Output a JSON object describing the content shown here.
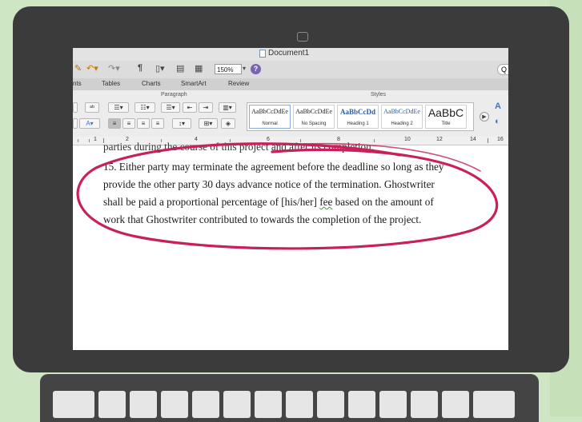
{
  "window": {
    "title": "Document1"
  },
  "toolbar": {
    "zoom": "150%",
    "help_label": "?",
    "search_label": "Q"
  },
  "tabs": [
    {
      "label": "nts"
    },
    {
      "label": "Tables"
    },
    {
      "label": "Charts"
    },
    {
      "label": "SmartArt"
    },
    {
      "label": "Review"
    }
  ],
  "ribbon": {
    "paragraph_group": "Paragraph",
    "styles_group": "Styles",
    "styles": [
      {
        "sample": "AaBbCcDdEe",
        "name": "Normal"
      },
      {
        "sample": "AaBbCcDdEe",
        "name": "No Spacing"
      },
      {
        "sample": "AaBbCcDd",
        "name": "Heading 1"
      },
      {
        "sample": "AaBbCcDdEe",
        "name": "Heading 2"
      },
      {
        "sample": "AaBbC",
        "name": "Title"
      }
    ]
  },
  "ruler": {
    "labels": [
      "1",
      "2",
      "4",
      "6",
      "8",
      "10",
      "12",
      "14",
      "16"
    ]
  },
  "document": {
    "clipped_line": "parties during the course of this project and after its completion.",
    "lines": [
      "15. Either party may terminate the agreement before the deadline so long as they",
      "provide the other party 30 days advance notice of the termination. Ghostwriter",
      "work that Ghostwriter contributed to towards the completion of the project."
    ],
    "line3_before": "shall be paid a proportional percentage of [his/her] ",
    "line3_flag": "fee",
    "line3_after": " based on the amount of"
  },
  "colors": {
    "background": "#cfe6c4",
    "laptop": "#3b3b3b",
    "annotation": "#c8205a"
  }
}
